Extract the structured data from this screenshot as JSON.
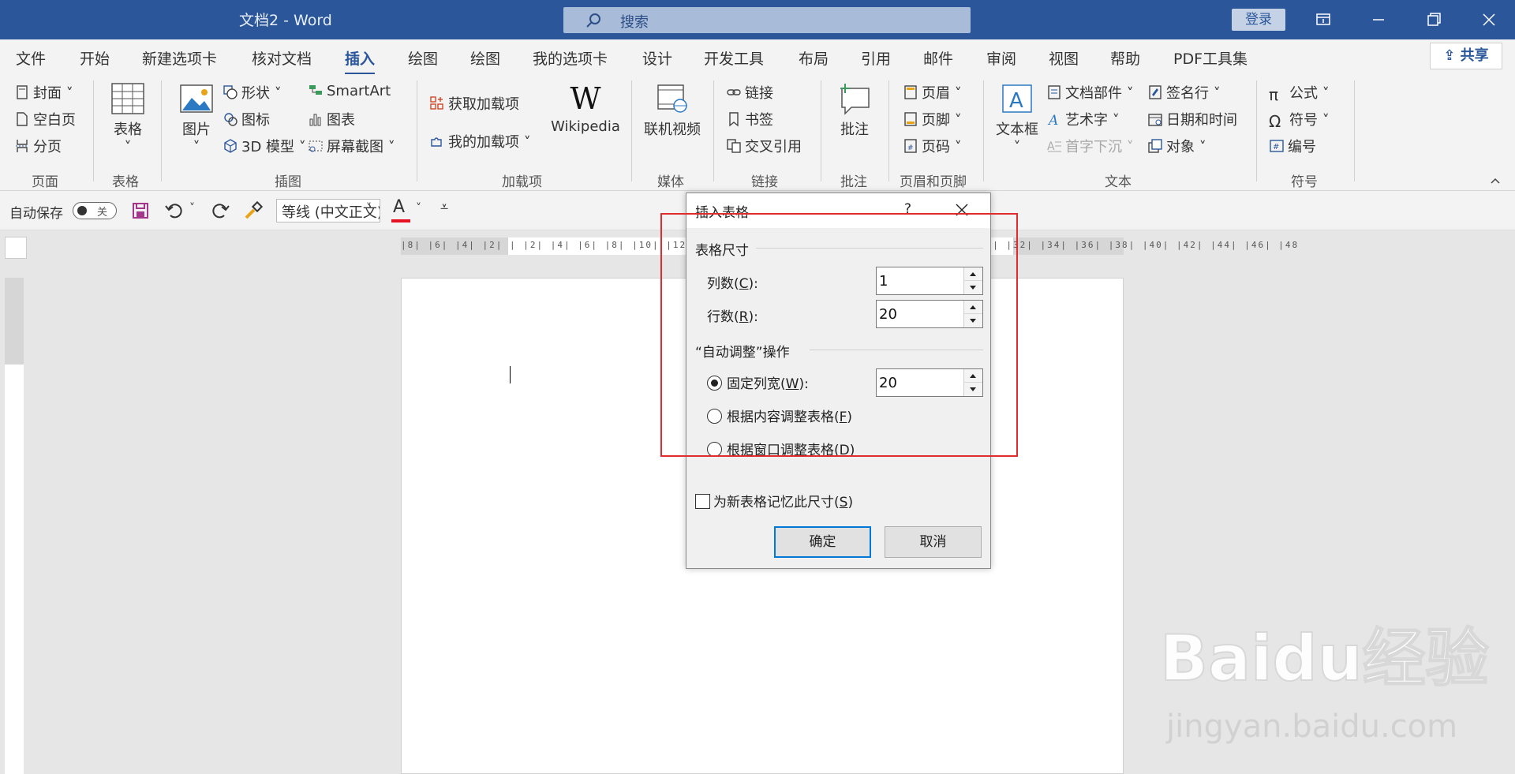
{
  "titlebar": {
    "title": "文档2  -  Word",
    "search_placeholder": "搜索",
    "login": "登录"
  },
  "tabs": [
    "文件",
    "开始",
    "新建选项卡",
    "核对文档",
    "插入",
    "绘图",
    "绘图",
    "我的选项卡",
    "设计",
    "开发工具",
    "布局",
    "引用",
    "邮件",
    "审阅",
    "视图",
    "帮助",
    "PDF工具集"
  ],
  "active_tab": "插入",
  "share": "共享",
  "ribbon": {
    "pages": {
      "cover": "封面",
      "blank": "空白页",
      "break": "分页",
      "label": "页面"
    },
    "tables": {
      "table": "表格",
      "label": "表格"
    },
    "illustrations": {
      "picture": "图片",
      "shapes": "形状",
      "icons": "图标",
      "model3d": "3D 模型",
      "smartart": "SmartArt",
      "chart": "图表",
      "screenshot": "屏幕截图",
      "label": "插图"
    },
    "addins": {
      "get": "获取加载项",
      "my": "我的加载项",
      "wikipedia": "Wikipedia",
      "label": "加载项"
    },
    "media": {
      "video": "联机视频",
      "label": "媒体"
    },
    "links": {
      "link": "链接",
      "bookmark": "书签",
      "cross": "交叉引用",
      "label": "链接"
    },
    "comments": {
      "comment": "批注",
      "label": "批注"
    },
    "header_footer": {
      "header": "页眉",
      "footer": "页脚",
      "page_num": "页码",
      "label": "页眉和页脚"
    },
    "text": {
      "textbox": "文本框",
      "parts": "文档部件",
      "wordart": "艺术字",
      "dropcap": "首字下沉",
      "signature": "签名行",
      "datetime": "日期和时间",
      "object": "对象",
      "label": "文本"
    },
    "symbols": {
      "equation": "公式",
      "symbol": "符号",
      "number": "编号",
      "label": "符号"
    }
  },
  "qat": {
    "autosave": "自动保存",
    "toggle": "关",
    "font": "等线 (中文正文)",
    "font_color": "#e81123"
  },
  "ruler": {
    "h_numbers": "|8|  |6|  |4|  |2|  |  |2|  |4|  |6|  |8|  |10|  |12|  |14|  |16|  |18|  |20|  |22|  |24|  |26|  |28|  |30|  |32|  |34|  |36|  |38|  |40|  |42|  |44|  |46|  |48"
  },
  "dialog": {
    "title": "插入表格",
    "help": "?",
    "size_section": "表格尺寸",
    "cols_label": "列数(",
    "cols_key": "C",
    "cols_tail": "):",
    "cols_value": "1",
    "rows_label": "行数(",
    "rows_key": "R",
    "rows_tail": "):",
    "rows_value": "20",
    "autofit_section": "“自动调整”操作",
    "fixed_label": "固定列宽(",
    "fixed_key": "W",
    "fixed_tail": "):",
    "fixed_value": "20",
    "content_label": "根据内容调整表格(",
    "content_key": "F",
    "window_label": "根据窗口调整表格(",
    "window_key": "D",
    "close_paren": ")",
    "remember_label": "为新表格记忆此尺寸(",
    "remember_key": "S",
    "ok": "确定",
    "cancel": "取消"
  },
  "watermark": {
    "brand": "Baidu经验",
    "url": "jingyan.baidu.com"
  },
  "colors": {
    "brand": "#2b579a",
    "highlight_box": "#e02c2c",
    "focus": "#0078d7"
  }
}
